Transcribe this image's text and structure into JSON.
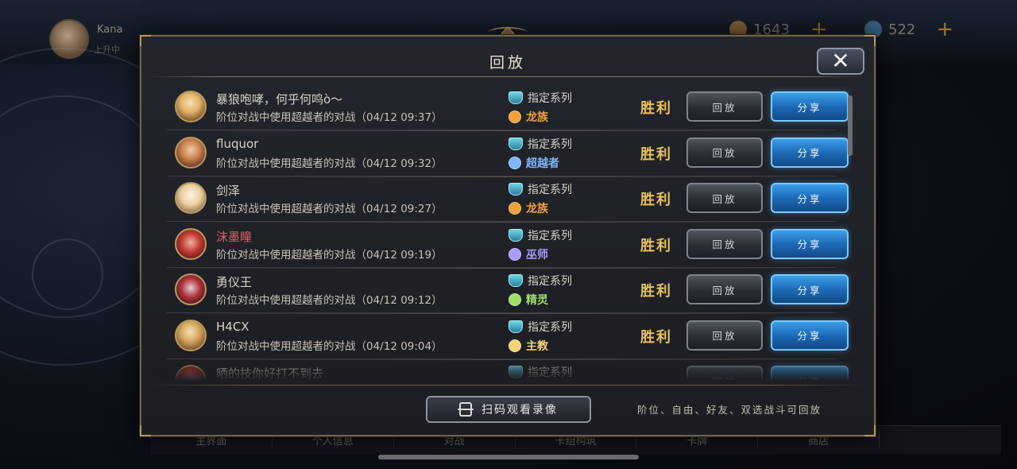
{
  "background": {
    "player_name": "Kana",
    "player_sub": "上升中",
    "resources": [
      {
        "value": "1643",
        "color": "#c48a3a"
      },
      {
        "value": "522",
        "color": "#4a86b0"
      }
    ],
    "bottom_tabs": [
      "主界面",
      "个人信息",
      "对战",
      "卡组构筑",
      "卡牌",
      "商店",
      ""
    ]
  },
  "modal": {
    "title": "回放",
    "close_glyph": "✕",
    "buttons": {
      "replay": "回放",
      "share": "分享"
    },
    "rows": [
      {
        "name": "暴狼咆哮，何乎何鸣ò～",
        "desc": "阶位对战中使用超越者的对战（04/12 09:37）",
        "mode": "指定系列",
        "class": "龙族",
        "class_color": "#f0a13a",
        "result": "胜利",
        "name_color": "normal"
      },
      {
        "name": "fluquor",
        "desc": "阶位对战中使用超越者的对战（04/12 09:32）",
        "mode": "指定系列",
        "class": "超越者",
        "class_color": "#7fb6ff",
        "result": "胜利",
        "name_color": "normal"
      },
      {
        "name": "剑泽",
        "desc": "阶位对战中使用超越者的对战（04/12 09:27）",
        "mode": "指定系列",
        "class": "龙族",
        "class_color": "#f0a13a",
        "result": "胜利",
        "name_color": "normal"
      },
      {
        "name": "沫墨瞳",
        "desc": "阶位对战中使用超越者的对战（04/12 09:19）",
        "mode": "指定系列",
        "class": "巫师",
        "class_color": "#a89cff",
        "result": "胜利",
        "name_color": "red"
      },
      {
        "name": "勇仪王",
        "desc": "阶位对战中使用超越者的对战（04/12 09:12）",
        "mode": "指定系列",
        "class": "精灵",
        "class_color": "#9ee06a",
        "result": "胜利",
        "name_color": "normal"
      },
      {
        "name": "H4CX",
        "desc": "阶位对战中使用超越者的对战（04/12 09:04）",
        "mode": "指定系列",
        "class": "主教",
        "class_color": "#f2d27a",
        "result": "胜利",
        "name_color": "normal"
      },
      {
        "name": "晒的技你好打不到去",
        "desc": "",
        "mode": "指定系列",
        "class": "",
        "class_color": "#f0a13a",
        "result": "",
        "name_color": "normal"
      }
    ],
    "scan_button": "扫码观看录像",
    "footer_note": "阶位、自由、好友、双选战斗可回放"
  }
}
